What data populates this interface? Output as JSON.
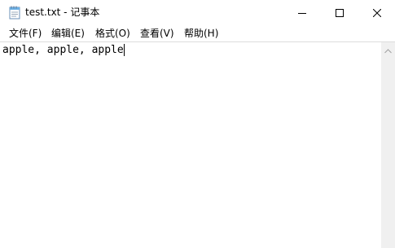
{
  "window": {
    "title": "test.txt - 记事本",
    "icon": "notepad-icon"
  },
  "menu": {
    "file": "文件(F)",
    "edit": "编辑(E)",
    "format": "格式(O)",
    "view": "查看(V)",
    "help": "帮助(H)"
  },
  "editor": {
    "content": "apple, apple, apple"
  },
  "colors": {
    "background": "#ffffff",
    "scrollbar": "#f0f0f0",
    "text": "#000000"
  }
}
